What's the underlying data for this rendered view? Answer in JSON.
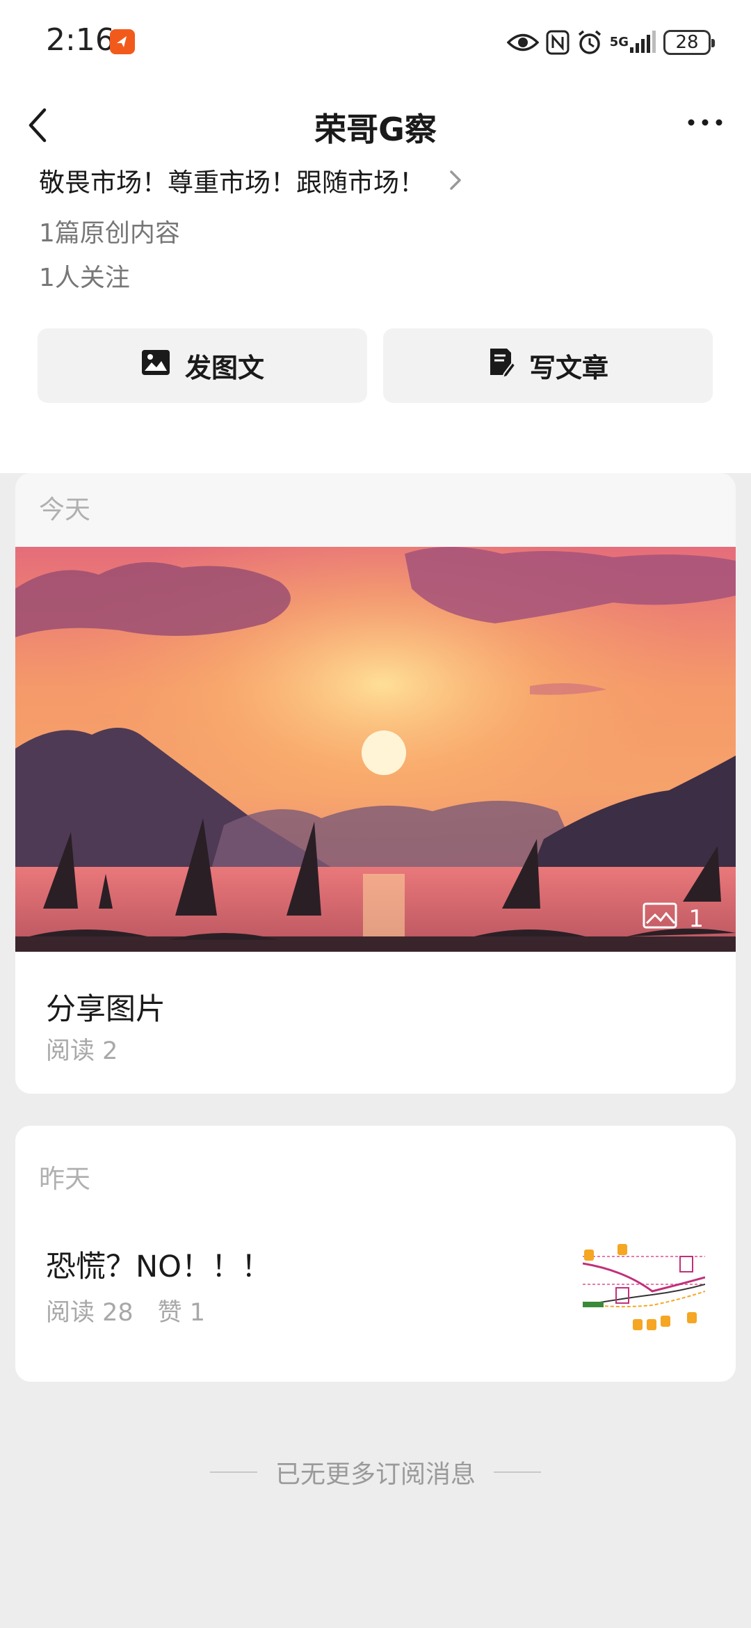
{
  "status": {
    "time": "2:16",
    "network": "5G",
    "battery": "28",
    "icons": [
      "app-badge-icon",
      "eye-icon",
      "nfc-icon",
      "alarm-icon",
      "signal-icon",
      "battery-icon"
    ]
  },
  "nav": {
    "title": "荣哥G察",
    "back_icon": "chevron-left-icon",
    "more_icon": "more-dots-icon"
  },
  "profile": {
    "description": "敬畏市场！尊重市场！跟随市场！",
    "original_count": "1篇原创内容",
    "followers": "1人关注"
  },
  "actions": {
    "post_image_label": "发图文",
    "write_article_label": "写文章"
  },
  "feed": {
    "groups": [
      {
        "day": "今天",
        "article": {
          "title": "分享图片",
          "meta": "阅读 2",
          "image_count": "1"
        }
      },
      {
        "day": "昨天",
        "article": {
          "title": "恐慌？NO！！！",
          "meta": "阅读 28　赞 1"
        }
      }
    ],
    "end_text": "已无更多订阅消息"
  },
  "colors": {
    "accent": "#f25a1c",
    "background": "#ededed",
    "card": "#ffffff"
  }
}
